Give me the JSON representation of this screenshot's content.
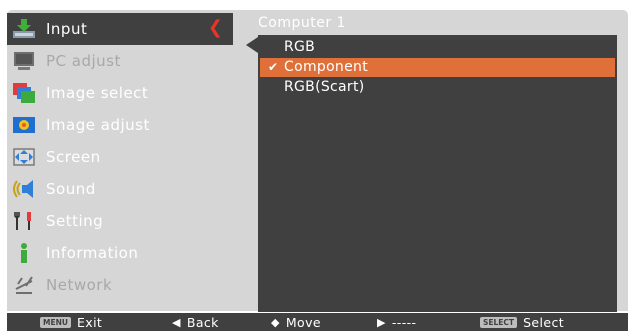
{
  "menu": {
    "items": [
      {
        "label": "Input",
        "icon": "input-icon",
        "state": "selected"
      },
      {
        "label": "PC adjust",
        "icon": "pc-adjust-icon",
        "state": "disabled"
      },
      {
        "label": "Image select",
        "icon": "image-select-icon",
        "state": "normal"
      },
      {
        "label": "Image adjust",
        "icon": "image-adjust-icon",
        "state": "normal"
      },
      {
        "label": "Screen",
        "icon": "screen-icon",
        "state": "normal"
      },
      {
        "label": "Sound",
        "icon": "sound-icon",
        "state": "normal"
      },
      {
        "label": "Setting",
        "icon": "setting-icon",
        "state": "normal"
      },
      {
        "label": "Information",
        "icon": "information-icon",
        "state": "normal"
      },
      {
        "label": "Network",
        "icon": "network-icon",
        "state": "disabled"
      }
    ],
    "selected_indicator": "❮"
  },
  "submenu": {
    "title": "Computer 1",
    "options": [
      {
        "label": "RGB",
        "selected": false
      },
      {
        "label": "Component",
        "selected": true
      },
      {
        "label": "RGB(Scart)",
        "selected": false
      }
    ],
    "check_mark": "✔"
  },
  "bottom_bar": {
    "exit": {
      "key": "MENU",
      "label": "Exit"
    },
    "back": {
      "glyph": "◀",
      "label": "Back"
    },
    "move": {
      "glyph": "◆",
      "label": "Move"
    },
    "next": {
      "glyph": "▶",
      "label": "-----"
    },
    "select": {
      "key": "SELECT",
      "label": "Select"
    }
  },
  "colors": {
    "panel_bg": "#d6d6d6",
    "dark_bg": "#404040",
    "highlight": "#e0703a",
    "indicator": "#e8342a"
  }
}
